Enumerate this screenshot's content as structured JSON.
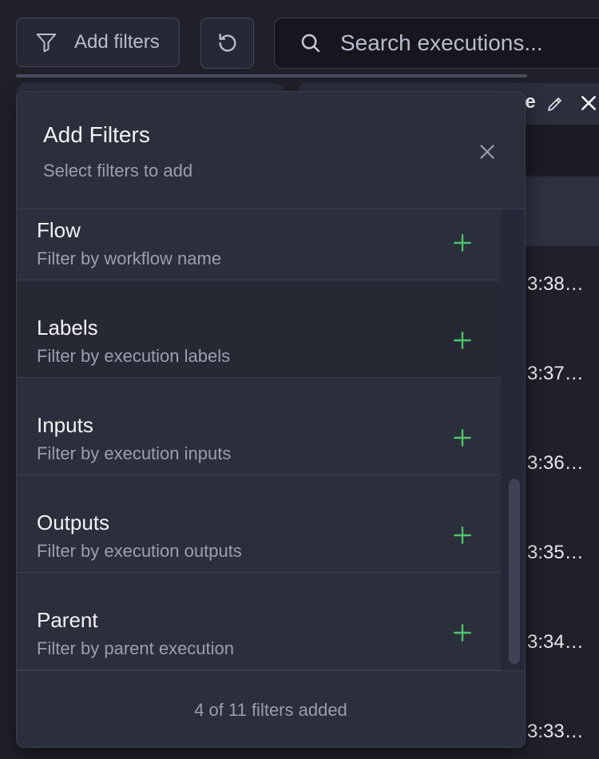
{
  "toolbar": {
    "filters_button_label": "Add filters",
    "search_placeholder": "Search executions..."
  },
  "background": {
    "tab_text": "re",
    "row_times": [
      "3:38…",
      "3:37…",
      "3:36…",
      "3:35…",
      "3:34…",
      "3:33…"
    ]
  },
  "modal": {
    "title": "Add Filters",
    "subtitle": "Select filters to add",
    "items": [
      {
        "title": "Flow",
        "description": "Filter by workflow name"
      },
      {
        "title": "Labels",
        "description": "Filter by execution labels"
      },
      {
        "title": "Inputs",
        "description": "Filter by execution inputs"
      },
      {
        "title": "Outputs",
        "description": "Filter by execution outputs"
      },
      {
        "title": "Parent",
        "description": "Filter by parent execution"
      }
    ],
    "footer": "4 of 11 filters added"
  },
  "colors": {
    "accent_add": "#4ec46a",
    "background": "#1f2029",
    "panel": "#2b2e3b"
  },
  "icons": {
    "filter": "filter-icon",
    "reset": "reset-icon",
    "search": "search-icon",
    "close": "close-icon",
    "add": "plus-icon",
    "edit": "pencil-icon"
  }
}
